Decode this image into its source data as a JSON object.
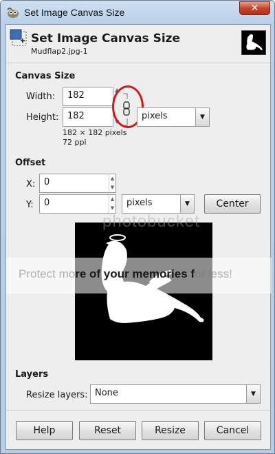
{
  "window": {
    "title": "Set Image Canvas Size",
    "close_glyph": "✕"
  },
  "header": {
    "title": "Set Image Canvas Size",
    "subtitle": "Mudflap2.jpg-1",
    "icon": "canvas-size-icon"
  },
  "canvas_size": {
    "section_label": "Canvas Size",
    "width_label": "Width:",
    "width_mnemonic": "W",
    "width_value": "182",
    "height_label": "Height:",
    "height_mnemonic": "i",
    "height_value": "182",
    "unit": "pixels",
    "dims_text": "182 × 182 pixels",
    "resolution_text": "72 ppi",
    "chain_icon": "chain-link-icon"
  },
  "offset": {
    "section_label": "Offset",
    "x_label": "X:",
    "x_value": "0",
    "y_label": "Y:",
    "y_value": "0",
    "unit": "pixels",
    "center_label": "Center"
  },
  "watermark": {
    "logo_text": "photobucket",
    "band_text_pre": "Protect mo",
    "band_text_bold": "re of your memories f",
    "band_text_post": "or less!"
  },
  "layers": {
    "section_label": "Layers",
    "resize_label": "Resize layers:",
    "resize_value": "None"
  },
  "buttons": {
    "help": "Help",
    "reset": "Reset",
    "resize": "Resize",
    "cancel": "Cancel"
  },
  "colors": {
    "annotation_ring": "#d21a1a",
    "titlebar": "#b9cfe8",
    "close": "#c7432b"
  }
}
